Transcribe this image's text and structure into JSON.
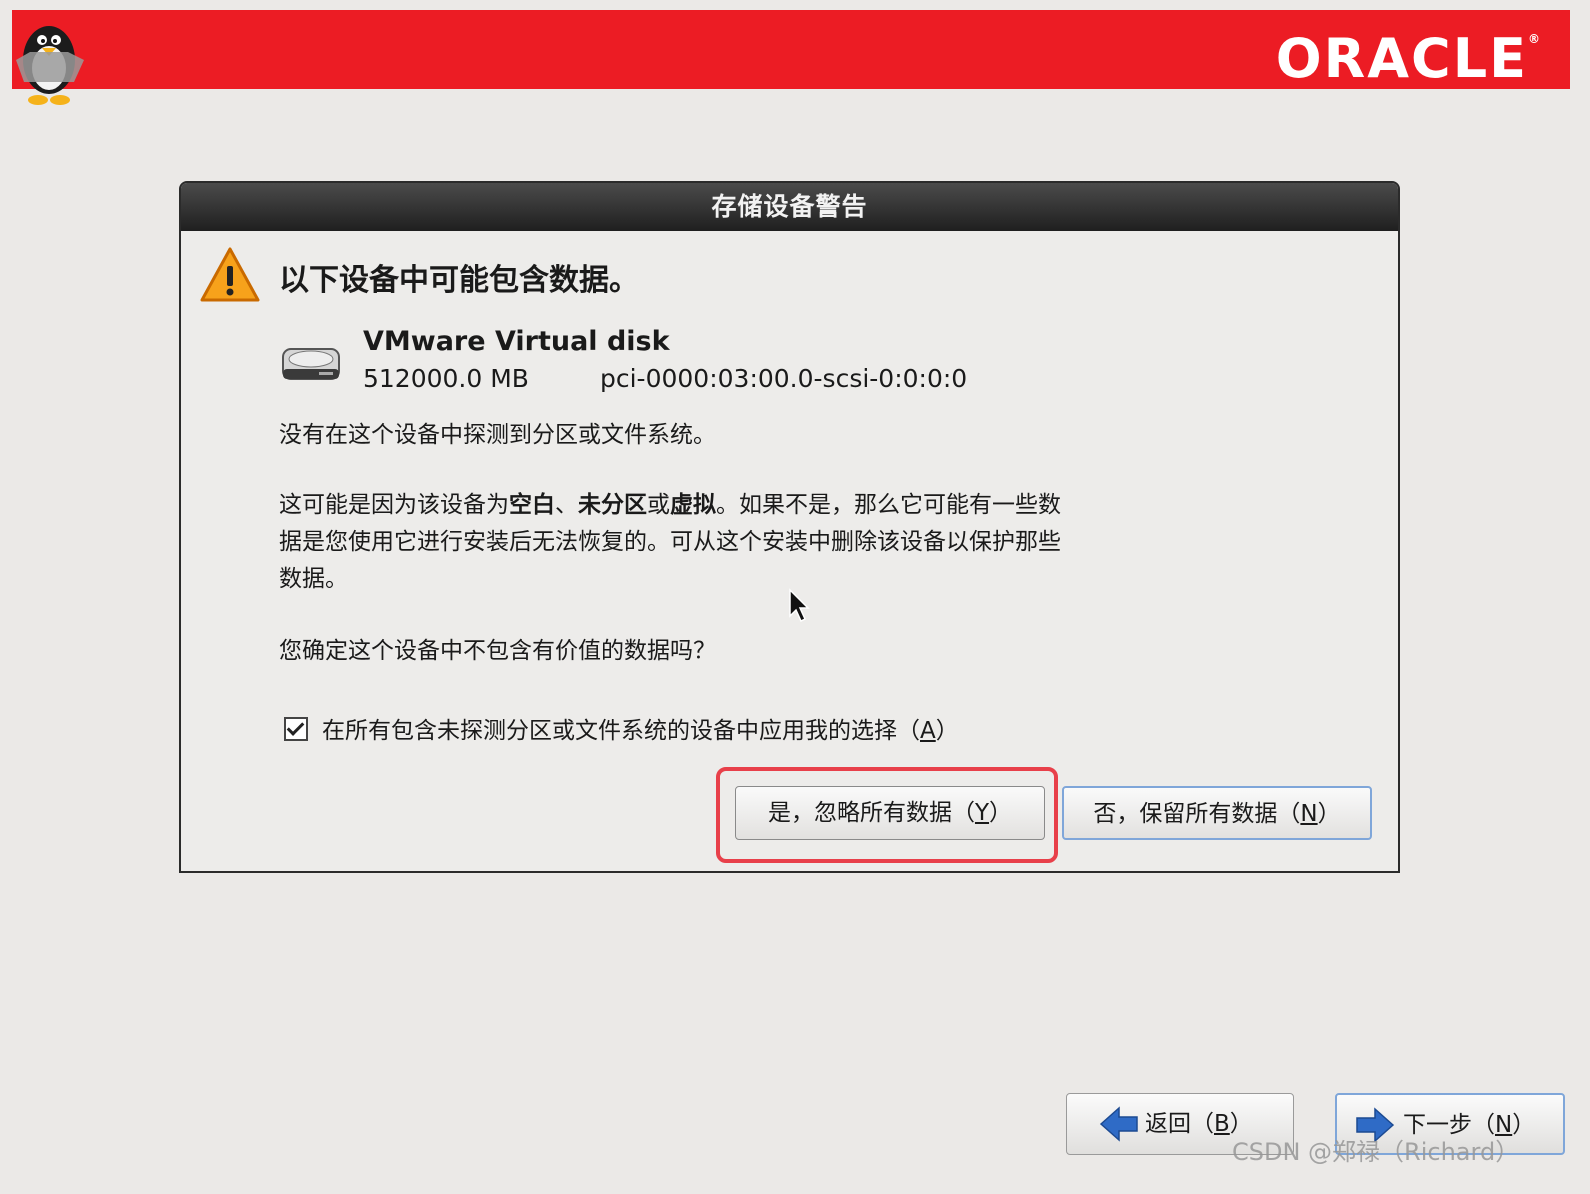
{
  "header": {
    "logo_text": "ORACLE",
    "logo_mark": "®"
  },
  "dialog": {
    "title": "存储设备警告",
    "heading": "以下设备中可能包含数据。",
    "device": {
      "name": "VMware Virtual disk",
      "size": "512000.0 MB",
      "path": "pci-0000:03:00.0-scsi-0:0:0:0"
    },
    "no_partition_text": "没有在这个设备中探测到分区或文件系统。",
    "explanation": {
      "part1": "这可能是因为该设备为",
      "blank": "空白",
      "sep1": "、",
      "unpartitioned": "未分区",
      "or": "或",
      "virtual": "虚拟",
      "part2": "。如果不是，那么它可能有一些数据是您使用它进行安装后无法恢复的。可从这个安装中删除该设备以保护那些数据。"
    },
    "confirm_question": "您确定这个设备中不包含有价值的数据吗？",
    "apply_all_checkbox": {
      "label": "在所有包含未探测分区或文件系统的设备中应用我的选择（",
      "mnemonic": "A",
      "close": "）",
      "checked": true
    },
    "yes_button": {
      "label": "是，忽略所有数据（",
      "mnemonic": "Y",
      "close": "）"
    },
    "no_button": {
      "label": "否，保留所有数据（",
      "mnemonic": "N",
      "close": "）"
    }
  },
  "nav": {
    "back_button": {
      "label": "返回（",
      "mnemonic": "B",
      "close": "）"
    },
    "next_button": {
      "label": "下一步（",
      "mnemonic": "N",
      "close": "）"
    }
  },
  "watermark": "CSDN @郑禄（Richard）",
  "colors": {
    "banner": "#ec1c24",
    "highlight": "#e8404a",
    "focus": "#7fa6d9"
  }
}
